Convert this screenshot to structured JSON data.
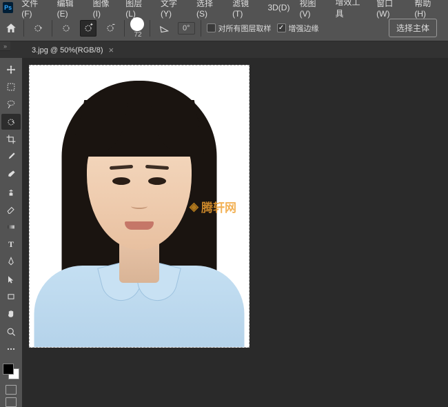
{
  "menus": {
    "file": "文件(F)",
    "edit": "编辑(E)",
    "image": "图像(I)",
    "layer": "图层(L)",
    "text": "文字(Y)",
    "select": "选择(S)",
    "filter": "滤镜(T)",
    "threed": "3D(D)",
    "view": "视图(V)",
    "plugins": "增效工具",
    "window": "窗口(W)",
    "help": "帮助(H)"
  },
  "options": {
    "brush_size": "72",
    "angle": "0°",
    "sample_all": "对所有图层取样",
    "smart_radius": "增强边缘",
    "select_subject": "选择主体"
  },
  "tab": {
    "title": "3.jpg @ 50%(RGB/8)"
  },
  "watermark": "腾轩网",
  "colors": {
    "fg": "#000000",
    "bg": "#ffffff"
  },
  "tools": [
    "move-tool",
    "marquee-tool",
    "lasso-tool",
    "quick-select-tool",
    "crop-tool",
    "eyedropper-tool",
    "brush-tool",
    "clone-tool",
    "eraser-tool",
    "gradient-tool",
    "type-tool",
    "pen-tool",
    "direct-select-tool",
    "rectangle-tool",
    "hand-tool",
    "zoom-tool"
  ],
  "active_tool": "quick-select-tool"
}
